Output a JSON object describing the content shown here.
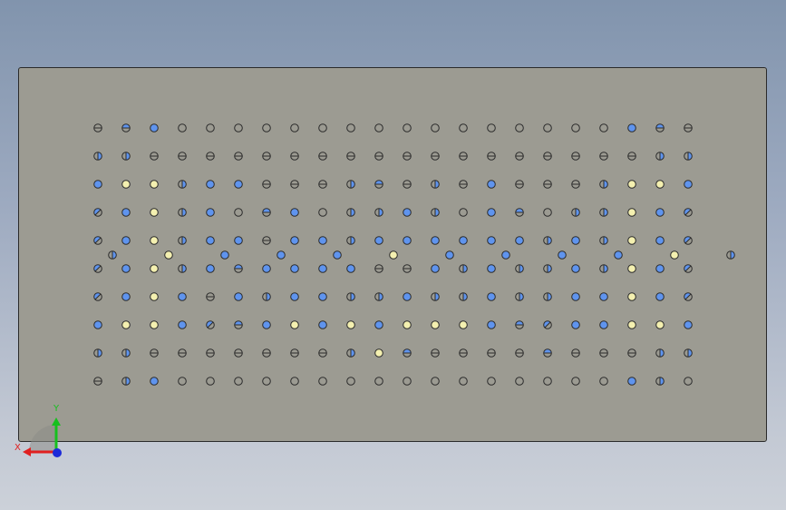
{
  "viewport": {
    "background_top": "#8194ad",
    "background_bottom": "#ccd1d9"
  },
  "plate": {
    "color": "#9c9b92",
    "edge_color": "#2a2a2a"
  },
  "hole_pattern": {
    "columns": 22,
    "rows": 10,
    "colors": {
      "blue": "#5f94ee",
      "yellow": "#f4f0b0",
      "outline": "#2b2b2b",
      "empty": "#9c9b92"
    },
    "grid_styles": [
      [
        "eh",
        "hh",
        "b",
        "e",
        "e",
        "e",
        "e",
        "e",
        "e",
        "e",
        "e",
        "e",
        "e",
        "e",
        "e",
        "e",
        "e",
        "e",
        "e",
        "b",
        "hh",
        "eh"
      ],
      [
        "hv",
        "hv",
        "eh",
        "eh",
        "eh",
        "eh",
        "eh",
        "eh",
        "eh",
        "eh",
        "eh",
        "eh",
        "eh",
        "eh",
        "eh",
        "eh",
        "eh",
        "eh",
        "eh",
        "eh",
        "hv",
        "hv"
      ],
      [
        "b",
        "y",
        "y",
        "hv",
        "b",
        "b",
        "eh",
        "eh",
        "eh",
        "hv",
        "hh",
        "eh",
        "hv",
        "eh",
        "b",
        "eh",
        "eh",
        "eh",
        "hv",
        "y",
        "y",
        "b"
      ],
      [
        "ed",
        "b",
        "y",
        "hv",
        "b",
        "e",
        "hh",
        "b",
        "e",
        "hv",
        "hv",
        "b",
        "hv",
        "e",
        "b",
        "hh",
        "e",
        "hv",
        "hv",
        "y",
        "b",
        "ed"
      ],
      [
        "hd",
        "b",
        "y",
        "hv",
        "b",
        "b",
        "eh",
        "b",
        "b",
        "hv",
        "b",
        "b",
        "b",
        "b",
        "b",
        "b",
        "hv",
        "b",
        "hv",
        "y",
        "b",
        "ed"
      ],
      [
        "ed",
        "b",
        "y",
        "hv",
        "b",
        "hh",
        "b",
        "b",
        "b",
        "b",
        "eh",
        "eh",
        "b",
        "hv",
        "b",
        "hv",
        "hv",
        "b",
        "hv",
        "y",
        "b",
        "hd"
      ],
      [
        "ed",
        "b",
        "y",
        "b",
        "eh",
        "b",
        "hv",
        "b",
        "b",
        "hv",
        "hv",
        "b",
        "hv",
        "hv",
        "b",
        "hv",
        "hv",
        "b",
        "b",
        "y",
        "b",
        "ed"
      ],
      [
        "b",
        "y",
        "y",
        "b",
        "ed",
        "hh",
        "b",
        "y",
        "b",
        "y",
        "b",
        "y",
        "y",
        "y",
        "b",
        "hh",
        "hd",
        "b",
        "b",
        "y",
        "y",
        "b"
      ],
      [
        "hv",
        "hv",
        "eh",
        "eh",
        "eh",
        "eh",
        "eh",
        "eh",
        "eh",
        "hv",
        "y",
        "hh",
        "eh",
        "eh",
        "eh",
        "eh",
        "hh",
        "eh",
        "eh",
        "eh",
        "hv",
        "hv"
      ],
      [
        "eh",
        "hv",
        "b",
        "e",
        "e",
        "e",
        "e",
        "e",
        "e",
        "e",
        "e",
        "e",
        "e",
        "e",
        "e",
        "e",
        "e",
        "e",
        "e",
        "b",
        "hv",
        "e"
      ]
    ],
    "mid_row_styles": [
      "hv",
      "y",
      "b",
      "b",
      "b",
      "y",
      "b",
      "b",
      "b",
      "b",
      "y",
      "hv"
    ]
  },
  "coordinate_triad": {
    "x_label": "X",
    "y_label": "Y",
    "x_color": "#e02020",
    "y_color": "#16c01e",
    "z_color": "#1c2ad8"
  }
}
